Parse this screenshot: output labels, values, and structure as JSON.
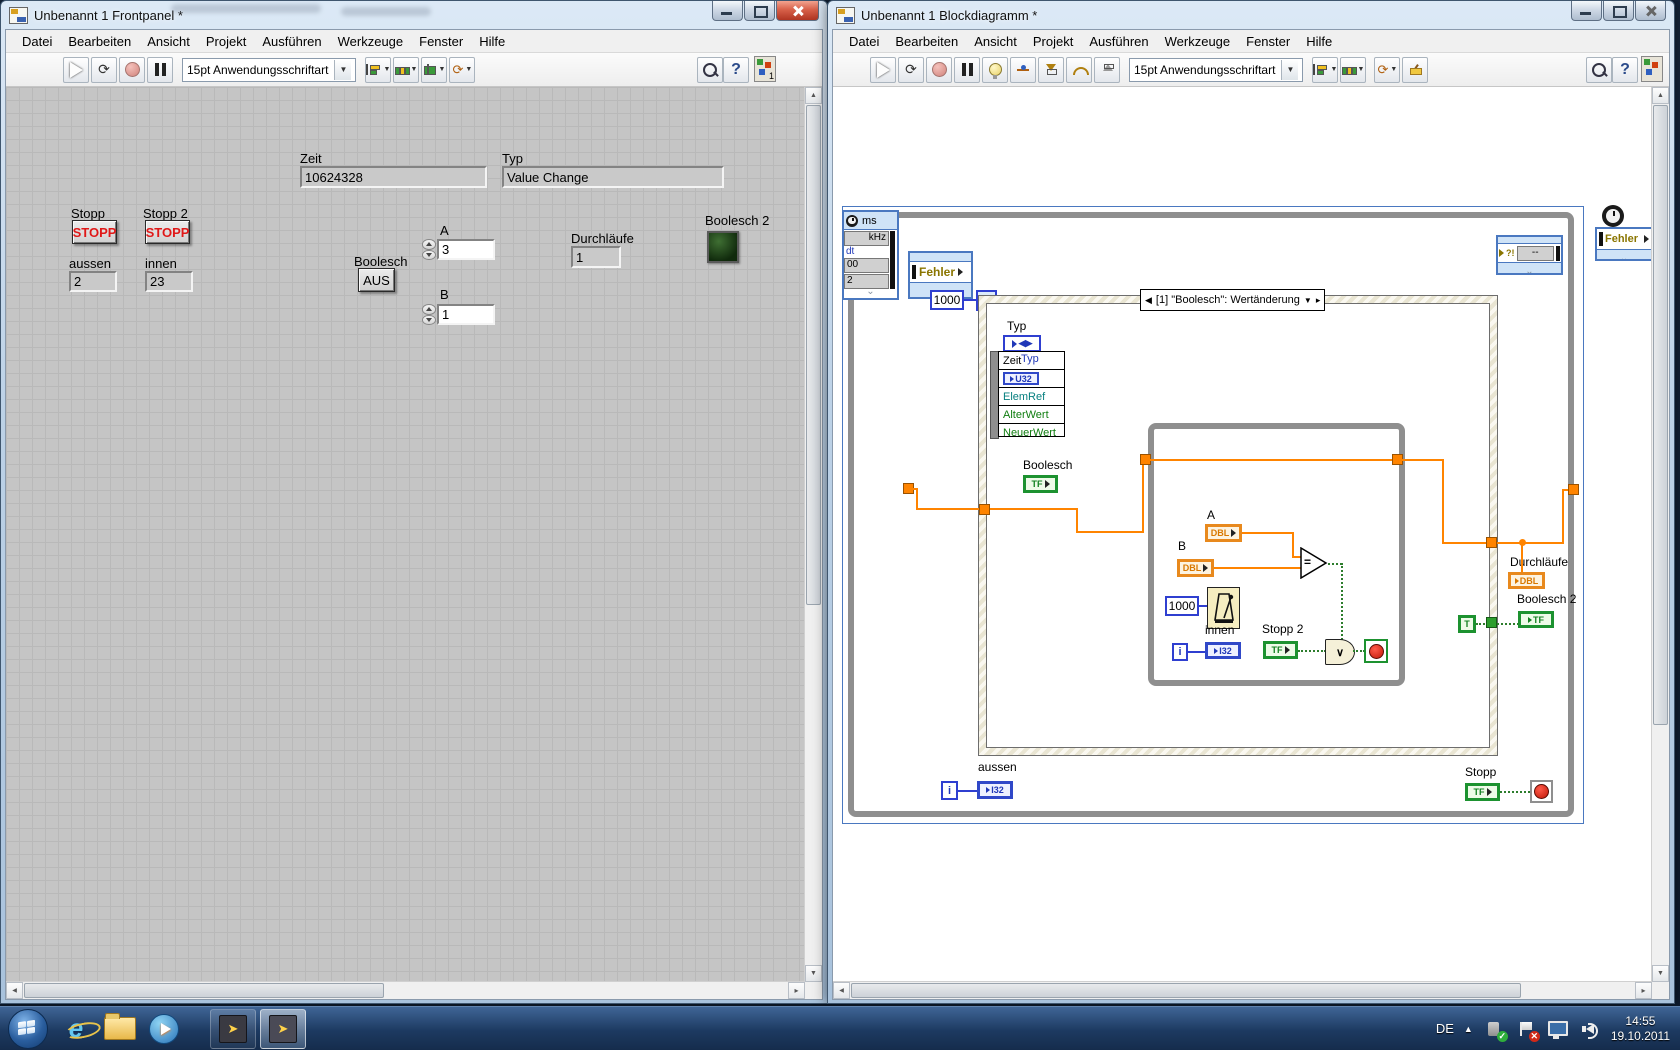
{
  "glyphs": {
    "right_tri": "▸",
    "left_tri": "◀",
    "down_tri": "▼",
    "up_tri": "▲",
    "chevron": "⌄",
    "or": "∨",
    "play": "➤",
    "refresh": "⟳",
    "help": "?",
    "ie": "e",
    "badge_one": "1",
    "hourglass": "⧗"
  },
  "menus": {
    "items": [
      "Datei",
      "Bearbeiten",
      "Ansicht",
      "Projekt",
      "Ausführen",
      "Werkzeuge",
      "Fenster",
      "Hilfe"
    ]
  },
  "font_selector": "15pt Anwendungsschriftart",
  "fp": {
    "title": "Unbenannt 1 Frontpanel *",
    "zeit_label": "Zeit",
    "zeit_value": "10624328",
    "typ_label": "Typ",
    "typ_value": "Value Change",
    "stopp_label": "Stopp",
    "stopp_btn": "STOPP",
    "stopp2_label": "Stopp 2",
    "stopp2_btn": "STOPP",
    "aussen_label": "aussen",
    "aussen_value": "2",
    "innen_label": "innen",
    "innen_value": "23",
    "boolesch_label": "Boolesch",
    "boolesch_btn": "AUS",
    "a_label": "A",
    "a_value": "3",
    "b_label": "B",
    "b_value": "1",
    "durchlaeufe_label": "Durchläufe",
    "durchlaeufe_value": "1",
    "boolesch2_label": "Boolesch 2"
  },
  "bd": {
    "title": "Unbenannt 1 Blockdiagramm *",
    "timed_ms": "ms",
    "timed_khz": "kHz",
    "timed_dt": "dt",
    "timed_v1": "00",
    "timed_v2": "2",
    "fehler_left": "Fehler",
    "fehler_right": "Fehler",
    "timeout_value": "1000",
    "event_case": "[1] \"Boolesch\": Wertänderung",
    "typ": "Typ",
    "zeit": "Zeit",
    "u32": "U32",
    "elemref": "ElemRef",
    "alterwert": "AlterWert",
    "neuerwert": "NeuerWert",
    "boolesch": "Boolesch",
    "tf": "TF",
    "a": "A",
    "b": "B",
    "dbl": "DBL",
    "eq": "=",
    "wait_value": "1000",
    "iter": "i",
    "innen": "innen",
    "i32": "I32",
    "stopp2": "Stopp 2",
    "t_const": "T",
    "boolesch2": "Boolesch 2",
    "durchlaeufe": "Durchläufe",
    "aussen": "aussen",
    "stopp": "Stopp",
    "right_vals": "--",
    "right_flag": "?!"
  },
  "taskbar": {
    "lang": "DE",
    "time": "14:55",
    "date": "19.10.2011"
  },
  "colors": {
    "wire_orange": "#ff8400",
    "wire_green": "#2d7d2d",
    "wire_blue": "#2f3fd0",
    "stopp_text": "#e01818",
    "led_off_green": "#14320f"
  }
}
